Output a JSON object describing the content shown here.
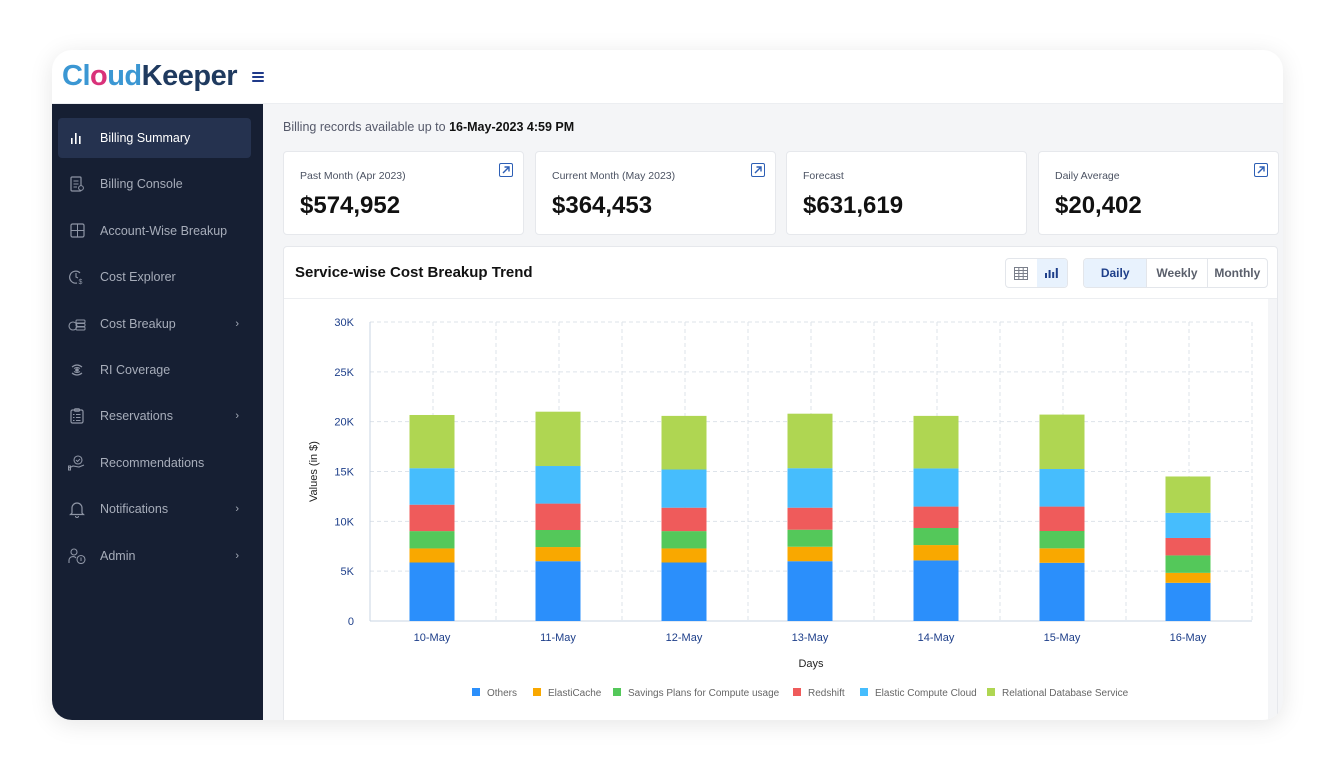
{
  "brand": {
    "logo_parts": [
      "Cl",
      "o",
      "ud",
      "Keeper"
    ]
  },
  "sidebar": {
    "items": [
      {
        "label": "Billing Summary",
        "icon": "bar-chart-icon",
        "active": true,
        "has_submenu": false
      },
      {
        "label": "Billing Console",
        "icon": "document-icon",
        "active": false,
        "has_submenu": false
      },
      {
        "label": "Account-Wise Breakup",
        "icon": "grid-icon",
        "active": false,
        "has_submenu": false
      },
      {
        "label": "Cost Explorer",
        "icon": "clock-dollar-icon",
        "active": false,
        "has_submenu": false
      },
      {
        "label": "Cost Breakup",
        "icon": "coins-icon",
        "active": false,
        "has_submenu": true
      },
      {
        "label": "RI Coverage",
        "icon": "signal-icon",
        "active": false,
        "has_submenu": false
      },
      {
        "label": "Reservations",
        "icon": "clipboard-icon",
        "active": false,
        "has_submenu": true
      },
      {
        "label": "Recommendations",
        "icon": "hand-check-icon",
        "active": false,
        "has_submenu": false
      },
      {
        "label": "Notifications",
        "icon": "bell-icon",
        "active": false,
        "has_submenu": true
      },
      {
        "label": "Admin",
        "icon": "user-shield-icon",
        "active": false,
        "has_submenu": true
      }
    ],
    "chevron": "›"
  },
  "records": {
    "prefix": "Billing records available up to",
    "timestamp": "16-May-2023 4:59 PM"
  },
  "kpis": [
    {
      "label": "Past Month (Apr 2023)",
      "value": "$574,952",
      "has_link": true
    },
    {
      "label": "Current Month (May 2023)",
      "value": "$364,453",
      "has_link": true
    },
    {
      "label": "Forecast",
      "value": "$631,619",
      "has_link": false
    },
    {
      "label": "Daily Average",
      "value": "$20,402",
      "has_link": true
    }
  ],
  "chart_card": {
    "title": "Service-wise Cost Breakup Trend",
    "view_toggle": [
      "table-view",
      "chart-view"
    ],
    "active_view": "chart-view",
    "periods": [
      "Daily",
      "Weekly",
      "Monthly"
    ],
    "active_period": "Daily"
  },
  "chart_data": {
    "type": "bar",
    "stacked": true,
    "title": "Service-wise Cost Breakup Trend",
    "xlabel": "Days",
    "ylabel": "Values (in $)",
    "ylim": [
      0,
      30000
    ],
    "yticks": [
      0,
      5000,
      10000,
      15000,
      20000,
      25000,
      30000
    ],
    "ytick_labels": [
      "0",
      "5K",
      "10K",
      "15K",
      "20K",
      "25K",
      "30K"
    ],
    "grid": true,
    "legend_position": "bottom",
    "categories": [
      "10-May",
      "11-May",
      "12-May",
      "13-May",
      "14-May",
      "15-May",
      "16-May"
    ],
    "series": [
      {
        "name": "Others",
        "color": "#2b8ffb",
        "values": [
          5870,
          6000,
          5870,
          6000,
          6080,
          5840,
          3830
        ]
      },
      {
        "name": "ElastiCache",
        "color": "#f9a800",
        "values": [
          1410,
          1420,
          1410,
          1450,
          1540,
          1450,
          1000
        ]
      },
      {
        "name": "Savings Plans for Compute usage",
        "color": "#54c85a",
        "values": [
          1740,
          1710,
          1740,
          1710,
          1710,
          1740,
          1750
        ]
      },
      {
        "name": "Redshift",
        "color": "#ef5b5b",
        "values": [
          2650,
          2650,
          2350,
          2210,
          2150,
          2450,
          1750
        ]
      },
      {
        "name": "Elastic Compute Cloud",
        "color": "#46bdfd",
        "values": [
          3660,
          3770,
          3830,
          3960,
          3830,
          3770,
          2520
        ]
      },
      {
        "name": "Relational Database Service",
        "color": "#afd652",
        "values": [
          5340,
          5450,
          5380,
          5470,
          5270,
          5460,
          3650
        ]
      }
    ]
  }
}
